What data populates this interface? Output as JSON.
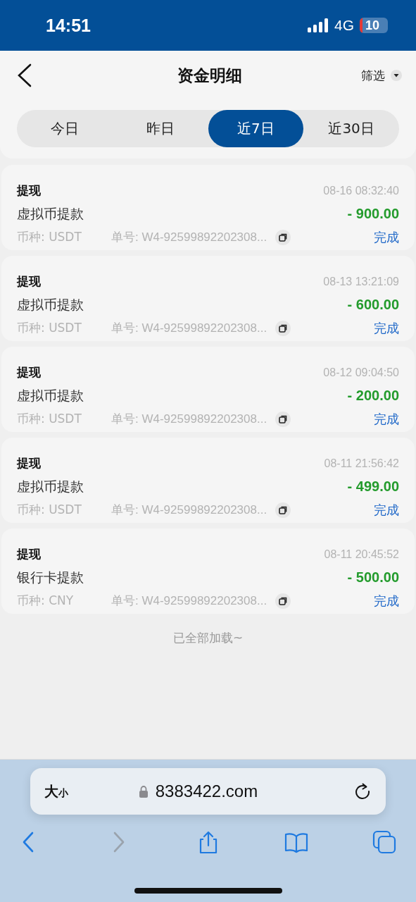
{
  "status_bar": {
    "time": "14:51",
    "network": "4G",
    "battery": "10"
  },
  "header": {
    "title": "资金明细",
    "filter": "筛选"
  },
  "tabs": [
    {
      "label": "今日",
      "selected": false
    },
    {
      "label": "昨日",
      "selected": false
    },
    {
      "label": "近7日",
      "selected": true
    },
    {
      "label": "近30日",
      "selected": false
    }
  ],
  "records": [
    {
      "type": "提现",
      "time": "08-16 08:32:40",
      "title": "虚拟币提款",
      "amount": "- 900.00",
      "currency": "币种: USDT",
      "order": "单号: W4-92599892202308...",
      "status": "完成"
    },
    {
      "type": "提现",
      "time": "08-13 13:21:09",
      "title": "虚拟币提款",
      "amount": "- 600.00",
      "currency": "币种: USDT",
      "order": "单号: W4-92599892202308...",
      "status": "完成"
    },
    {
      "type": "提现",
      "time": "08-12 09:04:50",
      "title": "虚拟币提款",
      "amount": "- 200.00",
      "currency": "币种: USDT",
      "order": "单号: W4-92599892202308...",
      "status": "完成"
    },
    {
      "type": "提现",
      "time": "08-11 21:56:42",
      "title": "虚拟币提款",
      "amount": "- 499.00",
      "currency": "币种: USDT",
      "order": "单号: W4-92599892202308...",
      "status": "完成"
    },
    {
      "type": "提现",
      "time": "08-11 20:45:52",
      "title": "银行卡提款",
      "amount": "- 500.00",
      "currency": "币种: CNY",
      "order": "单号: W4-92599892202308...",
      "status": "完成"
    }
  ],
  "footer_note": "已全部加载~",
  "browser": {
    "text_size_big": "大",
    "text_size_small": "小",
    "url": "8383422.com",
    "toolbar": [
      {
        "kind": "back",
        "disabled": false
      },
      {
        "kind": "forward",
        "disabled": true
      },
      {
        "kind": "share",
        "disabled": false
      },
      {
        "kind": "bookmarks",
        "disabled": false
      },
      {
        "kind": "tabs",
        "disabled": false
      }
    ]
  }
}
